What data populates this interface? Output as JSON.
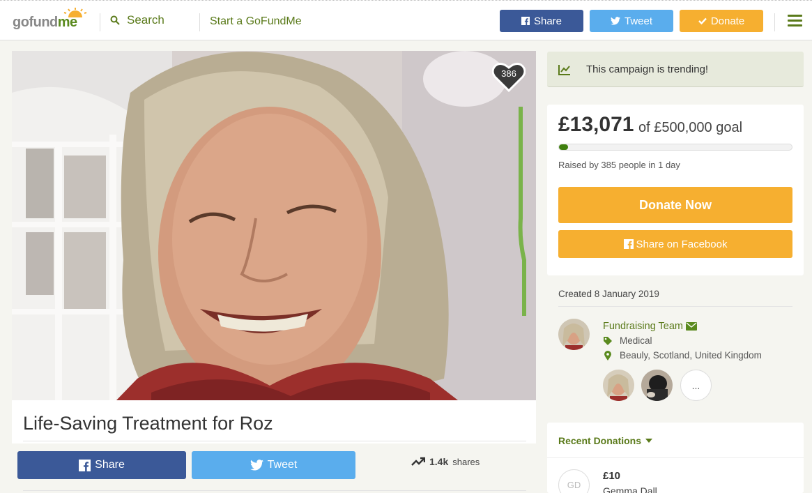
{
  "header": {
    "logo_go": "go",
    "logo_fund": "fund",
    "logo_me": "me",
    "search_label": "Search",
    "start_label": "Start a GoFundMe",
    "share_label": "Share",
    "tweet_label": "Tweet",
    "donate_label": "Donate"
  },
  "hero": {
    "heart_count": "386"
  },
  "campaign": {
    "title": "Life-Saving Treatment for Roz",
    "share_label": "Share",
    "tweet_label": "Tweet",
    "shares_count": "1.4k",
    "shares_word": "shares"
  },
  "sidebar": {
    "trending_text": "This campaign is trending!",
    "raised_amount": "£13,071",
    "goal_text": "of £500,000 goal",
    "progress_fraction": 0.026,
    "raised_by": "Raised by 385 people in 1 day",
    "donate_now_label": "Donate Now",
    "share_fb_label": "Share on Facebook",
    "created": "Created 8 January 2019",
    "organizer": "Fundraising Team",
    "category": "Medical",
    "location": "Beauly, Scotland, United Kingdom",
    "more_label": "..."
  },
  "recent": {
    "heading": "Recent Donations",
    "donations": [
      {
        "initials": "GD",
        "amount": "£10",
        "name": "Gemma Dall"
      }
    ]
  },
  "colors": {
    "facebook": "#3b5998",
    "twitter": "#5aaded",
    "donate": "#f6af30",
    "brand_green": "#5a7a1a"
  }
}
